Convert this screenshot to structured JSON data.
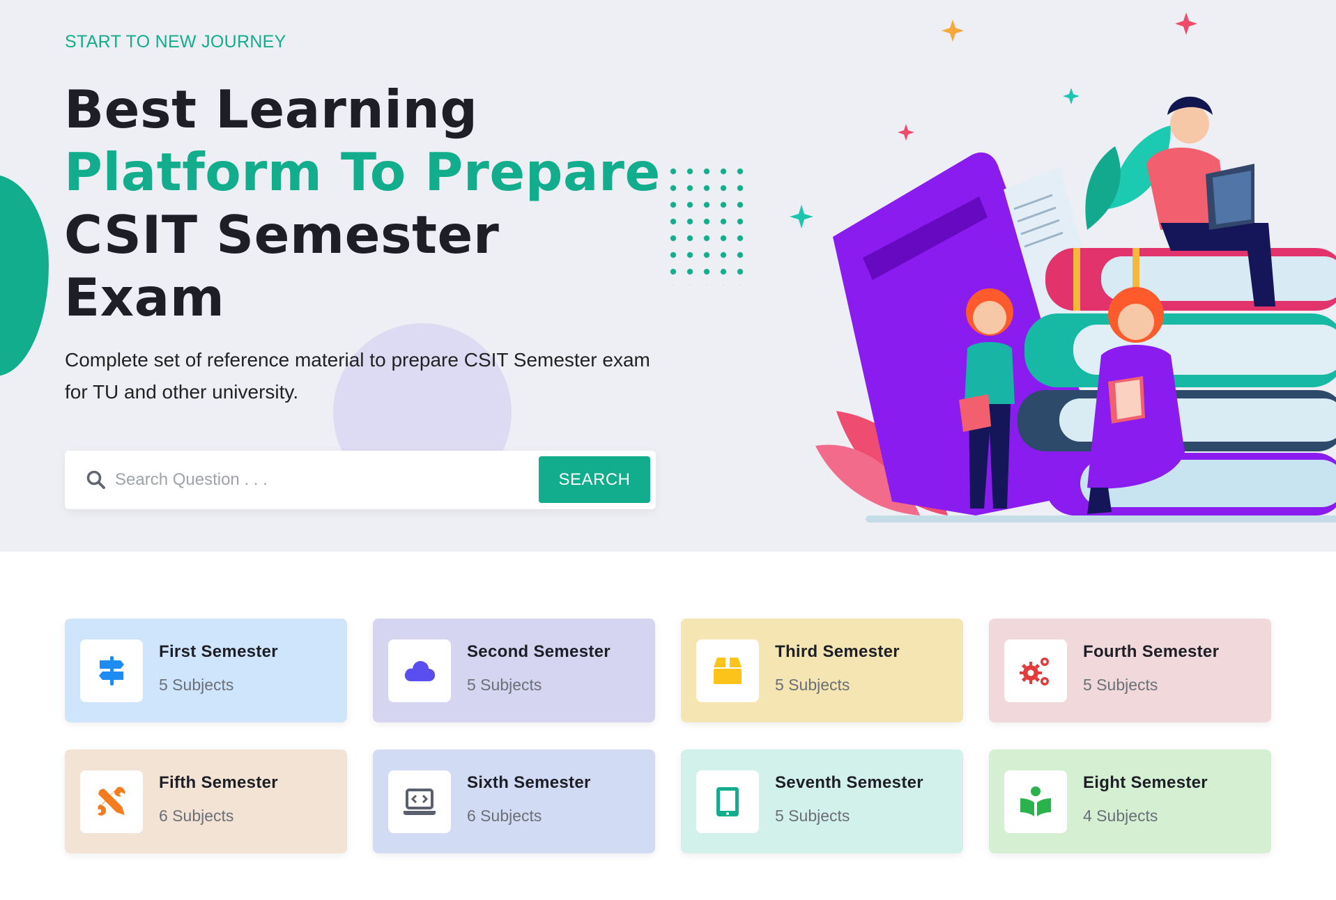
{
  "hero": {
    "eyebrow": "START TO NEW JOURNEY",
    "headline_line1": "Best Learning",
    "headline_line2": "Platform To Prepare",
    "headline_line3": "CSIT Semester",
    "headline_line4": "Exam",
    "description": "Complete set of reference material to prepare CSIT Semester exam for TU and other university."
  },
  "search": {
    "placeholder": "Search Question . . .",
    "button_label": "SEARCH"
  },
  "semesters": [
    {
      "title": "First Semester",
      "subjects": "5 Subjects",
      "icon": "signpost-icon",
      "bg": "#cfe5fb",
      "icon_color": "#1d8bf1"
    },
    {
      "title": "Second Semester",
      "subjects": "5 Subjects",
      "icon": "cloud-icon",
      "bg": "#d6d5f1",
      "icon_color": "#5b4ef0"
    },
    {
      "title": "Third Semester",
      "subjects": "5 Subjects",
      "icon": "box-icon",
      "bg": "#f5e5b3",
      "icon_color": "#fcc419"
    },
    {
      "title": "Fourth Semester",
      "subjects": "5 Subjects",
      "icon": "gears-icon",
      "bg": "#f1d8da",
      "icon_color": "#e13b3b"
    },
    {
      "title": "Fifth Semester",
      "subjects": "6 Subjects",
      "icon": "tools-icon",
      "bg": "#f3e3d5",
      "icon_color": "#f47c1f"
    },
    {
      "title": "Sixth Semester",
      "subjects": "6 Subjects",
      "icon": "laptop-code-icon",
      "bg": "#d1dbf3",
      "icon_color": "#5a5f6d"
    },
    {
      "title": "Seventh Semester",
      "subjects": "5 Subjects",
      "icon": "tablet-icon",
      "bg": "#d3f1eb",
      "icon_color": "#11ad8c"
    },
    {
      "title": "Eight Semester",
      "subjects": "4 Subjects",
      "icon": "reader-icon",
      "bg": "#d4efd2",
      "icon_color": "#2bb24c"
    }
  ]
}
